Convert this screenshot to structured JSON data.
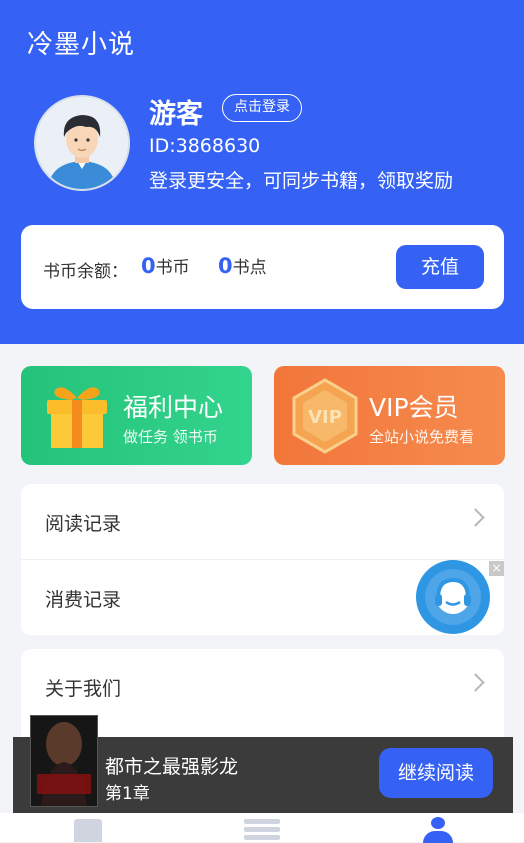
{
  "app": {
    "title": "冷墨小说"
  },
  "user": {
    "name": "游客",
    "login_label": "点击登录",
    "id_text": "ID:3868630",
    "tip": "登录更安全，可同步书籍，领取奖励"
  },
  "balance": {
    "label": "书币余额：",
    "coins_value": "0",
    "coins_unit": "书币",
    "points_value": "0",
    "points_unit": "书点",
    "recharge_label": "充值"
  },
  "promos": {
    "welfare": {
      "title": "福利中心",
      "subtitle": "做任务 领书币",
      "icon": "gift-icon"
    },
    "vip": {
      "title": "VIP会员",
      "subtitle": "全站小说免费看",
      "icon": "vip-badge-icon"
    }
  },
  "menu_group1": [
    {
      "label": "阅读记录"
    },
    {
      "label": "消费记录"
    }
  ],
  "menu_group2": [
    {
      "label": "关于我们"
    }
  ],
  "float": {
    "icon": "customer-service-icon",
    "close": "×"
  },
  "reading": {
    "book_title": "都市之最强影龙",
    "chapter": "第1章",
    "continue_label": "继续阅读"
  },
  "colors": {
    "primary": "#3562f5",
    "welfare": "#2ac884",
    "vip": "#f37a3e"
  }
}
